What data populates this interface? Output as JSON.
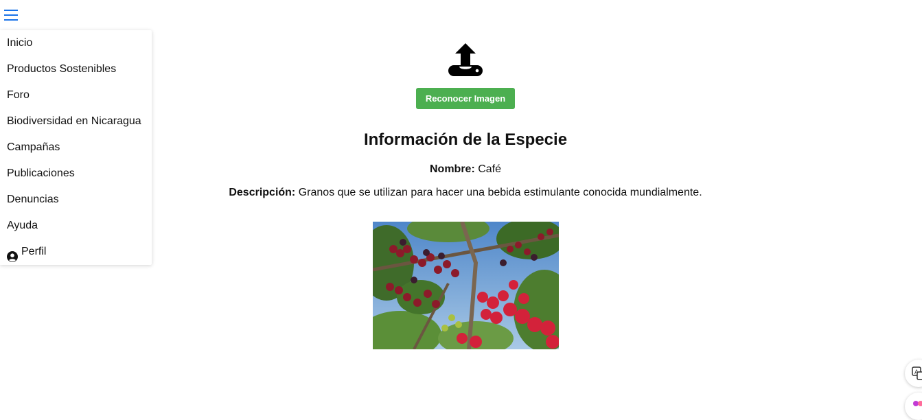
{
  "nav": {
    "menu_icon": "hamburger-icon",
    "items": [
      {
        "label": "Inicio"
      },
      {
        "label": "Productos Sostenibles"
      },
      {
        "label": "Foro"
      },
      {
        "label": "Biodiversidad en Nicaragua"
      },
      {
        "label": "Campañas"
      },
      {
        "label": "Publicaciones"
      },
      {
        "label": "Denuncias"
      },
      {
        "label": "Ayuda"
      },
      {
        "label": "Perfil",
        "icon": "user-circle-icon"
      }
    ]
  },
  "upload": {
    "icon": "upload-icon",
    "button_label": "Reconocer Imagen",
    "button_color": "#4caf50"
  },
  "species": {
    "title": "Información de la Especie",
    "name_label": "Nombre:",
    "name_value": "Café",
    "description_label": "Descripción:",
    "description_value": "Granos que se utilizan para hacer una bebida estimulante conocida mundialmente.",
    "image": "coffee-cherries-photo"
  },
  "floating": {
    "translate_icon": "translate-icon",
    "extra_icon": "assistant-icon"
  },
  "colors": {
    "menu_icon": "#1a73e8",
    "accent_green": "#4caf50"
  }
}
